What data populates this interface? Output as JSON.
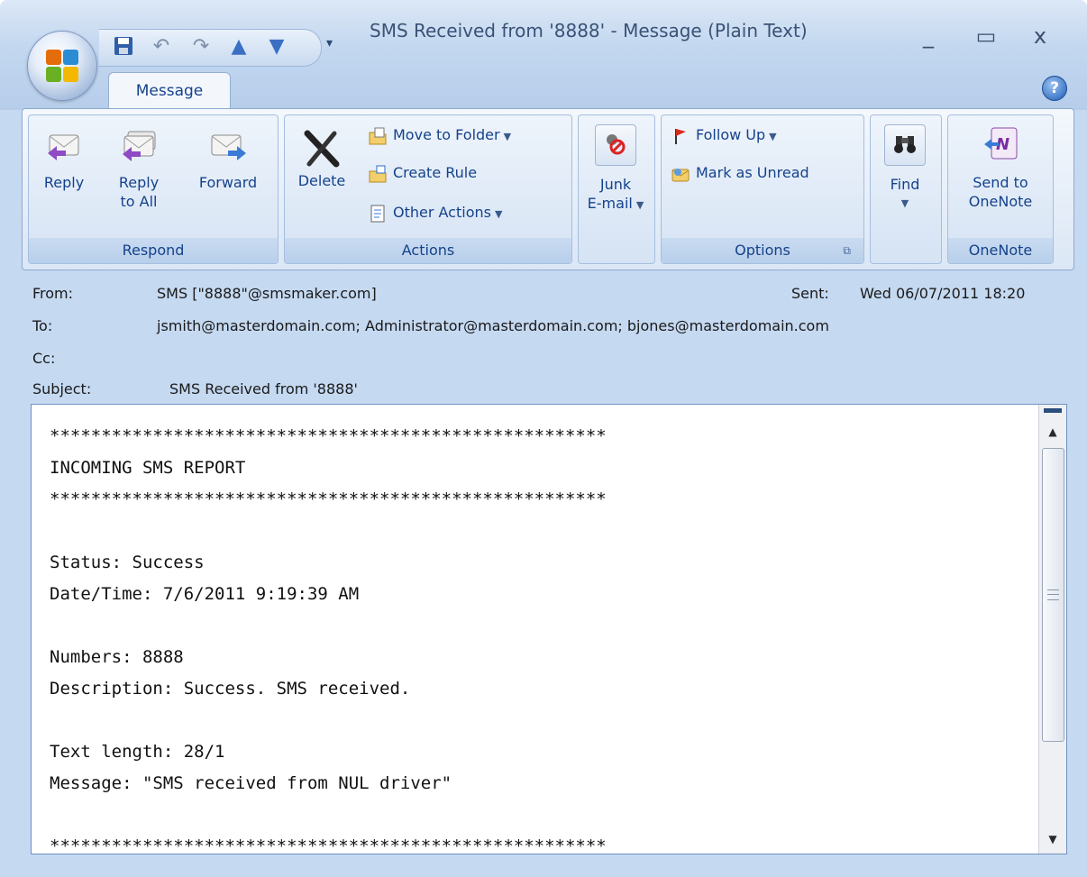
{
  "window": {
    "title": "SMS Received from '8888' - Message (Plain Text)",
    "minimize": "_",
    "maximize": "▭",
    "close": "x"
  },
  "ribbon": {
    "tab": "Message",
    "groups": {
      "respond": {
        "label": "Respond",
        "reply": "Reply",
        "reply_all_line1": "Reply",
        "reply_all_line2": "to All",
        "forward": "Forward"
      },
      "actions": {
        "label": "Actions",
        "delete": "Delete",
        "move_to_folder": "Move to Folder",
        "create_rule": "Create Rule",
        "other_actions": "Other Actions"
      },
      "junk": {
        "line1": "Junk",
        "line2": "E-mail"
      },
      "options": {
        "label": "Options",
        "follow_up": "Follow Up",
        "mark_unread": "Mark as Unread"
      },
      "find": {
        "label": "Find"
      },
      "onenote": {
        "label": "OneNote",
        "line1": "Send to",
        "line2": "OneNote"
      }
    }
  },
  "header": {
    "from_label": "From:",
    "from_value": "SMS [\"8888\"@smsmaker.com]",
    "sent_label": "Sent:",
    "sent_value": "Wed 06/07/2011 18:20",
    "to_label": "To:",
    "to_value": "jsmith@masterdomain.com; Administrator@masterdomain.com; bjones@masterdomain.com",
    "cc_label": "Cc:",
    "cc_value": "",
    "subject_label": "Subject:",
    "subject_value": "SMS Received from '8888'"
  },
  "body": {
    "text": "******************************************************\nINCOMING SMS REPORT\n******************************************************\n\nStatus: Success\nDate/Time: 7/6/2011 9:19:39 AM\n\nNumbers: 8888\nDescription: Success. SMS received.\n\nText length: 28/1\nMessage: \"SMS received from NUL driver\"\n\n******************************************************"
  },
  "colors": {
    "accent": "#15428b",
    "frame": "#c5d9f1"
  },
  "icons": {
    "office_button": "office-logo-icon",
    "save": "save-icon",
    "undo": "undo-icon",
    "redo": "redo-icon",
    "previous": "up-arrow-icon",
    "next": "down-arrow-icon"
  }
}
